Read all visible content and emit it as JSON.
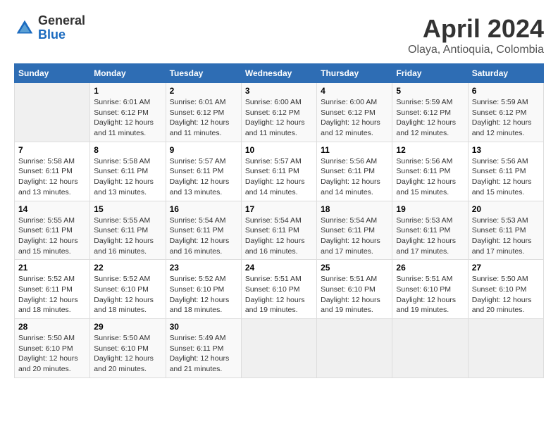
{
  "header": {
    "logo": {
      "line1": "General",
      "line2": "Blue"
    },
    "title": "April 2024",
    "subtitle": "Olaya, Antioquia, Colombia"
  },
  "days_of_week": [
    "Sunday",
    "Monday",
    "Tuesday",
    "Wednesday",
    "Thursday",
    "Friday",
    "Saturday"
  ],
  "weeks": [
    [
      {
        "day": "",
        "info": ""
      },
      {
        "day": "1",
        "info": "Sunrise: 6:01 AM\nSunset: 6:12 PM\nDaylight: 12 hours\nand 11 minutes."
      },
      {
        "day": "2",
        "info": "Sunrise: 6:01 AM\nSunset: 6:12 PM\nDaylight: 12 hours\nand 11 minutes."
      },
      {
        "day": "3",
        "info": "Sunrise: 6:00 AM\nSunset: 6:12 PM\nDaylight: 12 hours\nand 11 minutes."
      },
      {
        "day": "4",
        "info": "Sunrise: 6:00 AM\nSunset: 6:12 PM\nDaylight: 12 hours\nand 12 minutes."
      },
      {
        "day": "5",
        "info": "Sunrise: 5:59 AM\nSunset: 6:12 PM\nDaylight: 12 hours\nand 12 minutes."
      },
      {
        "day": "6",
        "info": "Sunrise: 5:59 AM\nSunset: 6:12 PM\nDaylight: 12 hours\nand 12 minutes."
      }
    ],
    [
      {
        "day": "7",
        "info": "Sunrise: 5:58 AM\nSunset: 6:11 PM\nDaylight: 12 hours\nand 13 minutes."
      },
      {
        "day": "8",
        "info": "Sunrise: 5:58 AM\nSunset: 6:11 PM\nDaylight: 12 hours\nand 13 minutes."
      },
      {
        "day": "9",
        "info": "Sunrise: 5:57 AM\nSunset: 6:11 PM\nDaylight: 12 hours\nand 13 minutes."
      },
      {
        "day": "10",
        "info": "Sunrise: 5:57 AM\nSunset: 6:11 PM\nDaylight: 12 hours\nand 14 minutes."
      },
      {
        "day": "11",
        "info": "Sunrise: 5:56 AM\nSunset: 6:11 PM\nDaylight: 12 hours\nand 14 minutes."
      },
      {
        "day": "12",
        "info": "Sunrise: 5:56 AM\nSunset: 6:11 PM\nDaylight: 12 hours\nand 15 minutes."
      },
      {
        "day": "13",
        "info": "Sunrise: 5:56 AM\nSunset: 6:11 PM\nDaylight: 12 hours\nand 15 minutes."
      }
    ],
    [
      {
        "day": "14",
        "info": "Sunrise: 5:55 AM\nSunset: 6:11 PM\nDaylight: 12 hours\nand 15 minutes."
      },
      {
        "day": "15",
        "info": "Sunrise: 5:55 AM\nSunset: 6:11 PM\nDaylight: 12 hours\nand 16 minutes."
      },
      {
        "day": "16",
        "info": "Sunrise: 5:54 AM\nSunset: 6:11 PM\nDaylight: 12 hours\nand 16 minutes."
      },
      {
        "day": "17",
        "info": "Sunrise: 5:54 AM\nSunset: 6:11 PM\nDaylight: 12 hours\nand 16 minutes."
      },
      {
        "day": "18",
        "info": "Sunrise: 5:54 AM\nSunset: 6:11 PM\nDaylight: 12 hours\nand 17 minutes."
      },
      {
        "day": "19",
        "info": "Sunrise: 5:53 AM\nSunset: 6:11 PM\nDaylight: 12 hours\nand 17 minutes."
      },
      {
        "day": "20",
        "info": "Sunrise: 5:53 AM\nSunset: 6:11 PM\nDaylight: 12 hours\nand 17 minutes."
      }
    ],
    [
      {
        "day": "21",
        "info": "Sunrise: 5:52 AM\nSunset: 6:11 PM\nDaylight: 12 hours\nand 18 minutes."
      },
      {
        "day": "22",
        "info": "Sunrise: 5:52 AM\nSunset: 6:10 PM\nDaylight: 12 hours\nand 18 minutes."
      },
      {
        "day": "23",
        "info": "Sunrise: 5:52 AM\nSunset: 6:10 PM\nDaylight: 12 hours\nand 18 minutes."
      },
      {
        "day": "24",
        "info": "Sunrise: 5:51 AM\nSunset: 6:10 PM\nDaylight: 12 hours\nand 19 minutes."
      },
      {
        "day": "25",
        "info": "Sunrise: 5:51 AM\nSunset: 6:10 PM\nDaylight: 12 hours\nand 19 minutes."
      },
      {
        "day": "26",
        "info": "Sunrise: 5:51 AM\nSunset: 6:10 PM\nDaylight: 12 hours\nand 19 minutes."
      },
      {
        "day": "27",
        "info": "Sunrise: 5:50 AM\nSunset: 6:10 PM\nDaylight: 12 hours\nand 20 minutes."
      }
    ],
    [
      {
        "day": "28",
        "info": "Sunrise: 5:50 AM\nSunset: 6:10 PM\nDaylight: 12 hours\nand 20 minutes."
      },
      {
        "day": "29",
        "info": "Sunrise: 5:50 AM\nSunset: 6:10 PM\nDaylight: 12 hours\nand 20 minutes."
      },
      {
        "day": "30",
        "info": "Sunrise: 5:49 AM\nSunset: 6:11 PM\nDaylight: 12 hours\nand 21 minutes."
      },
      {
        "day": "",
        "info": ""
      },
      {
        "day": "",
        "info": ""
      },
      {
        "day": "",
        "info": ""
      },
      {
        "day": "",
        "info": ""
      }
    ]
  ]
}
